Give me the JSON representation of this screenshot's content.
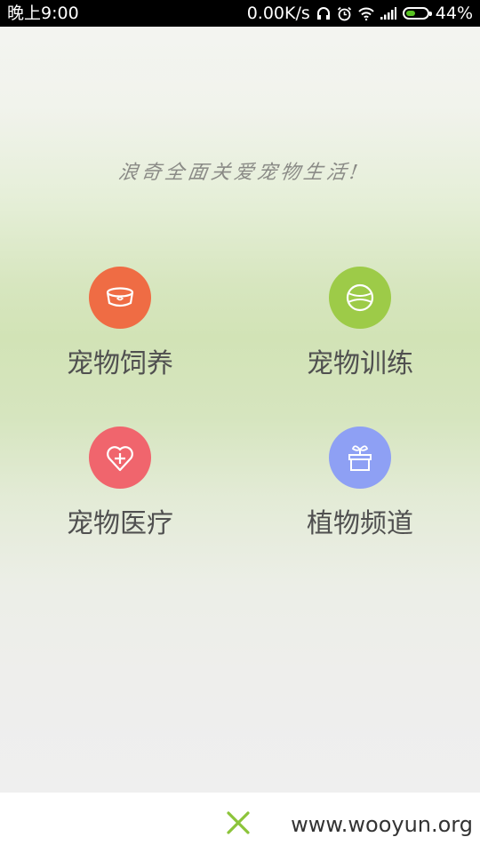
{
  "status_bar": {
    "time": "晚上9:00",
    "net_speed": "0.00K/s",
    "battery_text": "44%",
    "battery_level": 0.44,
    "icons": [
      "headset-icon",
      "alarm-clock-icon",
      "wifi-icon",
      "signal-icon",
      "battery-icon"
    ]
  },
  "tagline": "浪奇全面关爱宠物生活!",
  "menu": {
    "items": [
      {
        "label": "宠物饲养",
        "icon": "pet-bowl-icon",
        "color": "#ef6c44"
      },
      {
        "label": "宠物训练",
        "icon": "tennis-ball-icon",
        "color": "#9dcb48"
      },
      {
        "label": "宠物医疗",
        "icon": "heart-plus-icon",
        "color": "#f0656d"
      },
      {
        "label": "植物频道",
        "icon": "plant-pot-icon",
        "color": "#8ea0f4"
      }
    ]
  },
  "bottom_bar": {
    "close_icon": "close-icon",
    "close_color": "#8cc43a",
    "watermark": "www.wooyun.org"
  }
}
